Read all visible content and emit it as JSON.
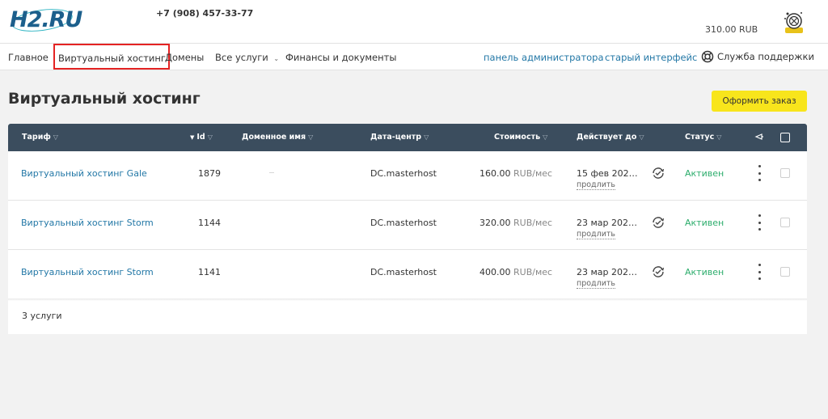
{
  "header": {
    "logo": "H2.RU",
    "phone": "+7 (908) 457-33-77",
    "balance": "310.00 RUB"
  },
  "nav": {
    "items": [
      {
        "label": "Главное"
      },
      {
        "label": "Виртуальный хостинг"
      },
      {
        "label": "Домены"
      },
      {
        "label": "Все услуги"
      },
      {
        "label": "Финансы и документы"
      }
    ],
    "admin_panel": "панель администратора",
    "old_interface": "старый интерфейс",
    "support": "Служба поддержки"
  },
  "page": {
    "title": "Виртуальный хостинг",
    "order_button": "Оформить заказ"
  },
  "table": {
    "columns": {
      "tariff": "Тариф",
      "id": "Id",
      "domain": "Доменное имя",
      "datacenter": "Дата-центр",
      "cost": "Стоимость",
      "valid_until": "Действует до",
      "status": "Статус"
    },
    "rows": [
      {
        "tariff": "Виртуальный хостинг Gale",
        "id": "1879",
        "datacenter": "DC.masterhost",
        "cost": "160.00",
        "unit": "RUB/мес",
        "valid_until": "15 фев 202…",
        "renew": "продлить",
        "status": "Активен"
      },
      {
        "tariff": "Виртуальный хостинг Storm",
        "id": "1144",
        "datacenter": "DC.masterhost",
        "cost": "320.00",
        "unit": "RUB/мес",
        "valid_until": "23 мар 202…",
        "renew": "продлить",
        "status": "Активен"
      },
      {
        "tariff": "Виртуальный хостинг Storm",
        "id": "1141",
        "datacenter": "DC.masterhost",
        "cost": "400.00",
        "unit": "RUB/мес",
        "valid_until": "23 мар 202…",
        "renew": "продлить",
        "status": "Активен"
      }
    ],
    "footer": "3 услуги"
  },
  "colors": {
    "accent_link": "#2277a6",
    "header_bg": "#3b4d5e",
    "status_active": "#2cad6c",
    "order_button_bg": "#f8e51c",
    "highlight_box": "#e42323"
  }
}
